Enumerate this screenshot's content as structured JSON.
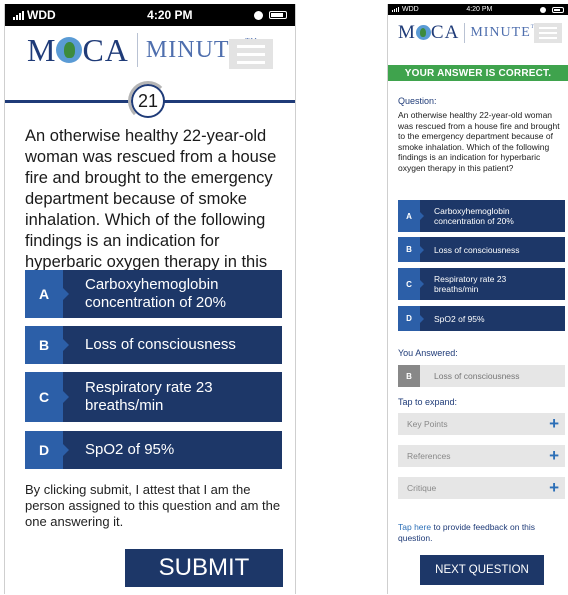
{
  "status_bar": {
    "carrier": "WDD",
    "time": "4:20 PM"
  },
  "logo": {
    "left": "M",
    "right": "CA",
    "product": "MINUTE",
    "trademark": "TM"
  },
  "question_number": "21",
  "question_text": "An otherwise healthy 22-year-old woman was rescued from a house fire and brought to the emergency department because of smoke inhalation. Which of the following findings is an indication for hyperbaric oxygen therapy in this patient?",
  "options": [
    {
      "letter": "A",
      "text": "Carboxyhemoglobin concentration of 20%"
    },
    {
      "letter": "B",
      "text": "Loss of consciousness"
    },
    {
      "letter": "C",
      "text": "Respiratory rate 23 breaths/min"
    },
    {
      "letter": "D",
      "text": "SpO2 of 95%"
    }
  ],
  "attestation": "By clicking submit, I attest that I am the person assigned to this question and am the one answering it.",
  "submit_label": "SUBMIT",
  "result_banner": "YOUR ANSWER IS CORRECT.",
  "question_label": "Question:",
  "you_answered_label": "You Answered:",
  "you_answered": {
    "letter": "B",
    "text": "Loss of consciousness"
  },
  "tap_to_expand_label": "Tap to expand:",
  "expand_sections": [
    {
      "label": "Key Points"
    },
    {
      "label": "References"
    },
    {
      "label": "Critique"
    }
  ],
  "feedback": {
    "link_text": "Tap here",
    "rest_text": " to provide feedback on this question."
  },
  "next_label": "NEXT QUESTION",
  "colors": {
    "navy": "#1d3768",
    "letter_blue": "#2c5fa8",
    "correct_green": "#3fa34d",
    "link_blue": "#2c6fb7"
  }
}
